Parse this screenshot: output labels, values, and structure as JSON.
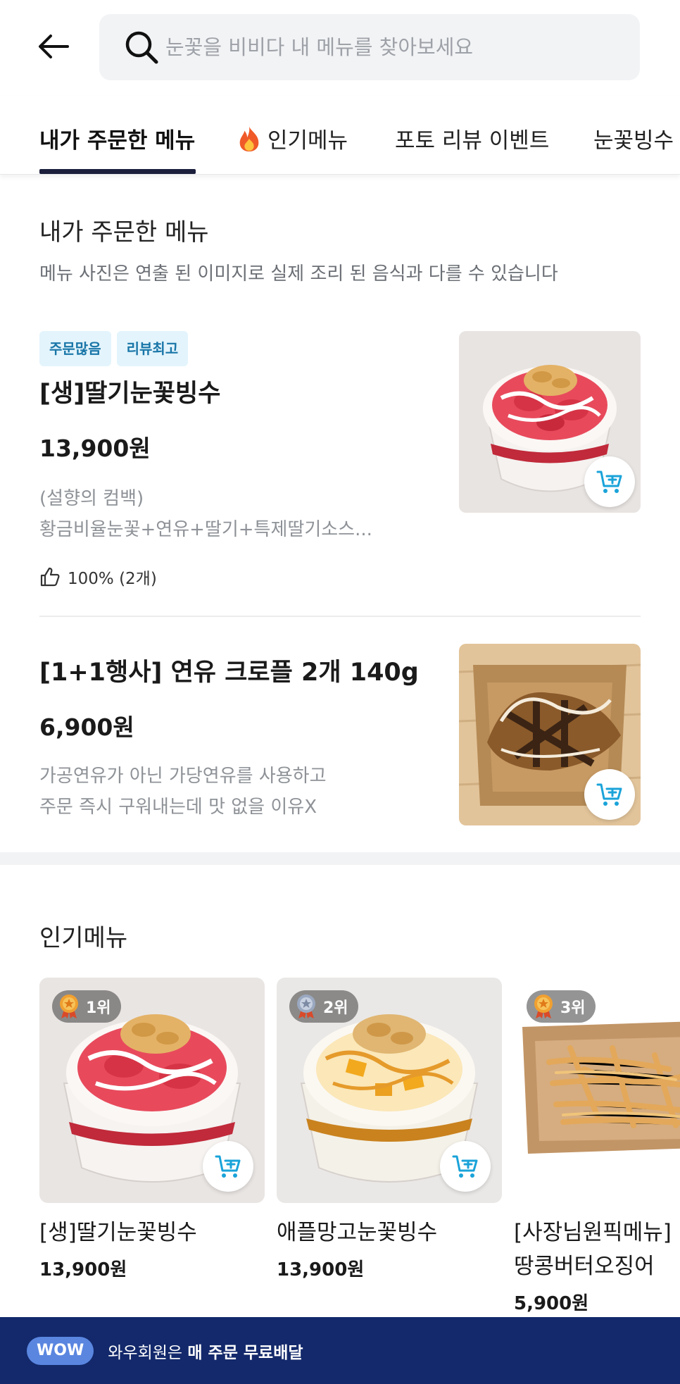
{
  "search": {
    "placeholder": "눈꽃을 비비다 내 메뉴를 찾아보세요"
  },
  "tabs": [
    {
      "label": "내가 주문한 메뉴",
      "active": true
    },
    {
      "label": "인기메뉴",
      "icon": "fire-icon"
    },
    {
      "label": "포토 리뷰 이벤트"
    },
    {
      "label": "눈꽃빙수"
    }
  ],
  "ordered_section": {
    "title": "내가 주문한 메뉴",
    "subtitle": "메뉴 사진은 연출 된 이미지로 실제 조리 된 음식과 다를 수 있습니다",
    "items": [
      {
        "badges": [
          "주문많음",
          "리뷰최고"
        ],
        "name": "[생]딸기눈꽃빙수",
        "price": "13,900원",
        "desc_line1": "(설향의 컴백)",
        "desc_line2": "황금비율눈꽃+연유+딸기+특제딸기소스...",
        "like": "100% (2개)"
      },
      {
        "name": "[1+1행사] 연유 크로플 2개 140g",
        "price": "6,900원",
        "desc_line1": "가공연유가 아닌 가당연유를 사용하고",
        "desc_line2": "주문 즉시 구워내는데 맛 없을 이유X"
      }
    ]
  },
  "popular_section": {
    "title": "인기메뉴",
    "items": [
      {
        "rank": "1위",
        "name_line1": "[생]딸기눈꽃빙수",
        "name_line2": "",
        "price": "13,900원",
        "medal_color": "#f0a030"
      },
      {
        "rank": "2위",
        "name_line1": "애플망고눈꽃빙수",
        "name_line2": "",
        "price": "13,900원",
        "medal_color": "#9aa8c0"
      },
      {
        "rank": "3위",
        "name_line1": "[사장님원픽메뉴]",
        "name_line2": "땅콩버터오징어",
        "price": "5,900원",
        "medal_color": "#f0a030"
      }
    ]
  },
  "wow_banner": {
    "pill": "WOW",
    "text_normal": "와우회원은 ",
    "text_bold": "매 주문 무료배달"
  },
  "colors": {
    "accent_cart": "#1aa3d9",
    "tab_underline": "#1b1f3b",
    "banner_bg": "#13296b"
  }
}
